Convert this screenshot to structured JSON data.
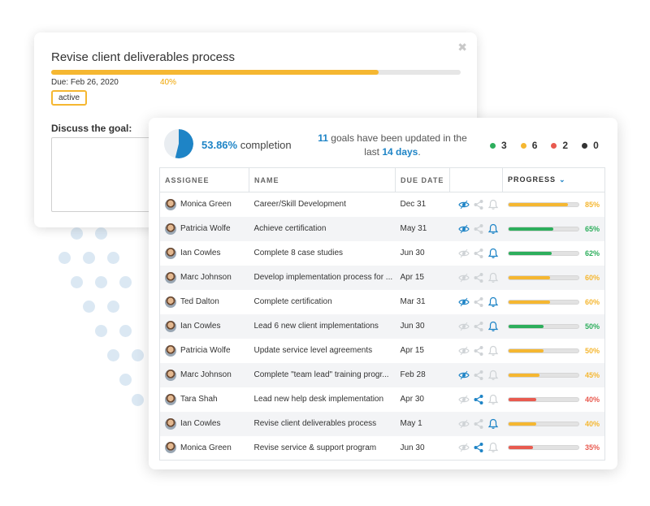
{
  "detail": {
    "goal_title": "Revise client deliverables process",
    "due": "Due: Feb 26, 2020",
    "progress_percent": "40%",
    "progress": 0.8,
    "status": "active",
    "discuss_label": "Discuss the goal:"
  },
  "summary": {
    "completion_value": "53.86%",
    "completion_label": " completion",
    "completion_fraction": 0.5386,
    "updated_count": "11",
    "updated_text_1": " goals have been updated in the last ",
    "updated_days": "14 days",
    "updated_text_2": ".",
    "counts": [
      {
        "color": "#2dae5c",
        "value": "3"
      },
      {
        "color": "#f5b731",
        "value": "6"
      },
      {
        "color": "#e85a4f",
        "value": "2"
      },
      {
        "color": "#333333",
        "value": "0"
      }
    ]
  },
  "table": {
    "headers": {
      "assignee": "ASSIGNEE",
      "name": "NAME",
      "due_date": "DUE DATE",
      "progress": "PROGRESS"
    },
    "rows": [
      {
        "assignee": "Monica Green",
        "name": "Career/Skill Development",
        "due": "Dec 31",
        "eye": true,
        "share": false,
        "bell": false,
        "progress": 0.85,
        "pct": "85%",
        "color": "#f5b731"
      },
      {
        "assignee": "Patricia Wolfe",
        "name": "Achieve certification",
        "due": "May 31",
        "eye": true,
        "share": false,
        "bell": true,
        "progress": 0.65,
        "pct": "65%",
        "color": "#2dae5c"
      },
      {
        "assignee": "Ian Cowles",
        "name": "Complete 8 case studies",
        "due": "Jun 30",
        "eye": false,
        "share": false,
        "bell": true,
        "progress": 0.62,
        "pct": "62%",
        "color": "#2dae5c"
      },
      {
        "assignee": "Marc Johnson",
        "name": "Develop implementation process for ...",
        "due": "Apr 15",
        "eye": false,
        "share": false,
        "bell": false,
        "progress": 0.6,
        "pct": "60%",
        "color": "#f5b731"
      },
      {
        "assignee": "Ted Dalton",
        "name": "Complete certification",
        "due": "Mar 31",
        "eye": true,
        "share": false,
        "bell": true,
        "progress": 0.6,
        "pct": "60%",
        "color": "#f5b731"
      },
      {
        "assignee": "Ian Cowles",
        "name": "Lead 6 new client implementations",
        "due": "Jun 30",
        "eye": false,
        "share": false,
        "bell": true,
        "progress": 0.5,
        "pct": "50%",
        "color": "#2dae5c"
      },
      {
        "assignee": "Patricia Wolfe",
        "name": "Update service level agreements",
        "due": "Apr 15",
        "eye": false,
        "share": false,
        "bell": false,
        "progress": 0.5,
        "pct": "50%",
        "color": "#f5b731"
      },
      {
        "assignee": "Marc Johnson",
        "name": "Complete \"team lead\" training progr...",
        "due": "Feb 28",
        "eye": true,
        "share": false,
        "bell": false,
        "progress": 0.45,
        "pct": "45%",
        "color": "#f5b731"
      },
      {
        "assignee": "Tara Shah",
        "name": "Lead new help desk implementation",
        "due": "Apr 30",
        "eye": false,
        "share": true,
        "bell": false,
        "progress": 0.4,
        "pct": "40%",
        "color": "#e85a4f"
      },
      {
        "assignee": "Ian Cowles",
        "name": "Revise client deliverables process",
        "due": "May 1",
        "eye": false,
        "share": false,
        "bell": true,
        "progress": 0.4,
        "pct": "40%",
        "color": "#f5b731"
      },
      {
        "assignee": "Monica Green",
        "name": "Revise service & support program",
        "due": "Jun 30",
        "eye": false,
        "share": true,
        "bell": false,
        "progress": 0.35,
        "pct": "35%",
        "color": "#e85a4f"
      }
    ]
  },
  "colors": {
    "accent": "#1e84c6",
    "yellow": "#f5b731",
    "green": "#2dae5c",
    "red": "#e85a4f",
    "inactive_icon": "#cfd3d6"
  },
  "icons": {
    "close": "close-icon",
    "eye": "eye-icon",
    "share": "share-icon",
    "bell": "bell-icon",
    "sort": "chevron-down-icon"
  }
}
